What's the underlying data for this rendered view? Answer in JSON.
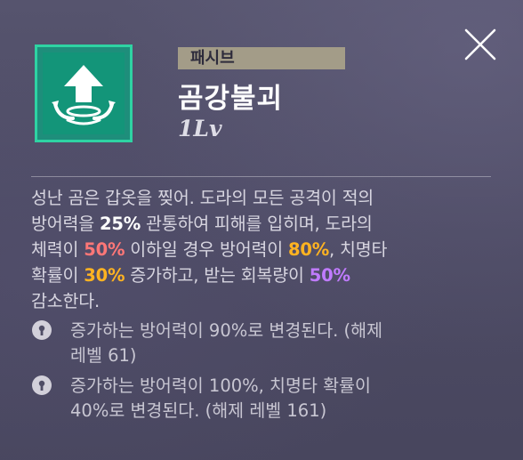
{
  "skill": {
    "type_label": "패시브",
    "name": "곰강불괴",
    "level": "1Lv"
  },
  "description": {
    "line1": "성난 곰은 갑옷을 찢어. 도라의 모든 공격이 적의",
    "line2_a": "방어력을 ",
    "line2_b": "25%",
    "line2_c": " 관통하여 피해를 입히며, 도라의",
    "line3_a": "체력이 ",
    "line3_b": "50%",
    "line3_c": " 이하일 경우 방어력이 ",
    "line3_d": "80%",
    "line3_e": ", 치명타",
    "line4_a": "확률이 ",
    "line4_b": "30%",
    "line4_c": " 증가하고, 받는 회복량이 ",
    "line4_d": "50%",
    "line5": "감소한다."
  },
  "unlocks": [
    {
      "line1": "증가하는 방어력이 90%로 변경된다. (해제",
      "line2": "레벨 61)"
    },
    {
      "line1": "증가하는 방어력이 100%, 치명타 확률이",
      "line2": "40%로 변경된다. (해제 레벨 161)"
    }
  ],
  "colors": {
    "background": "#4f4d66",
    "icon_frame": "#2ed3a3",
    "icon_fill": "#16a184",
    "badge": "#a39c88",
    "highlight_red": "#ff7777",
    "highlight_orange": "#ffb321",
    "highlight_purple": "#c07bff"
  },
  "icons": {
    "close": "close-x-icon",
    "skill": "up-arrow-aura-icon",
    "lock": "lock-icon"
  }
}
